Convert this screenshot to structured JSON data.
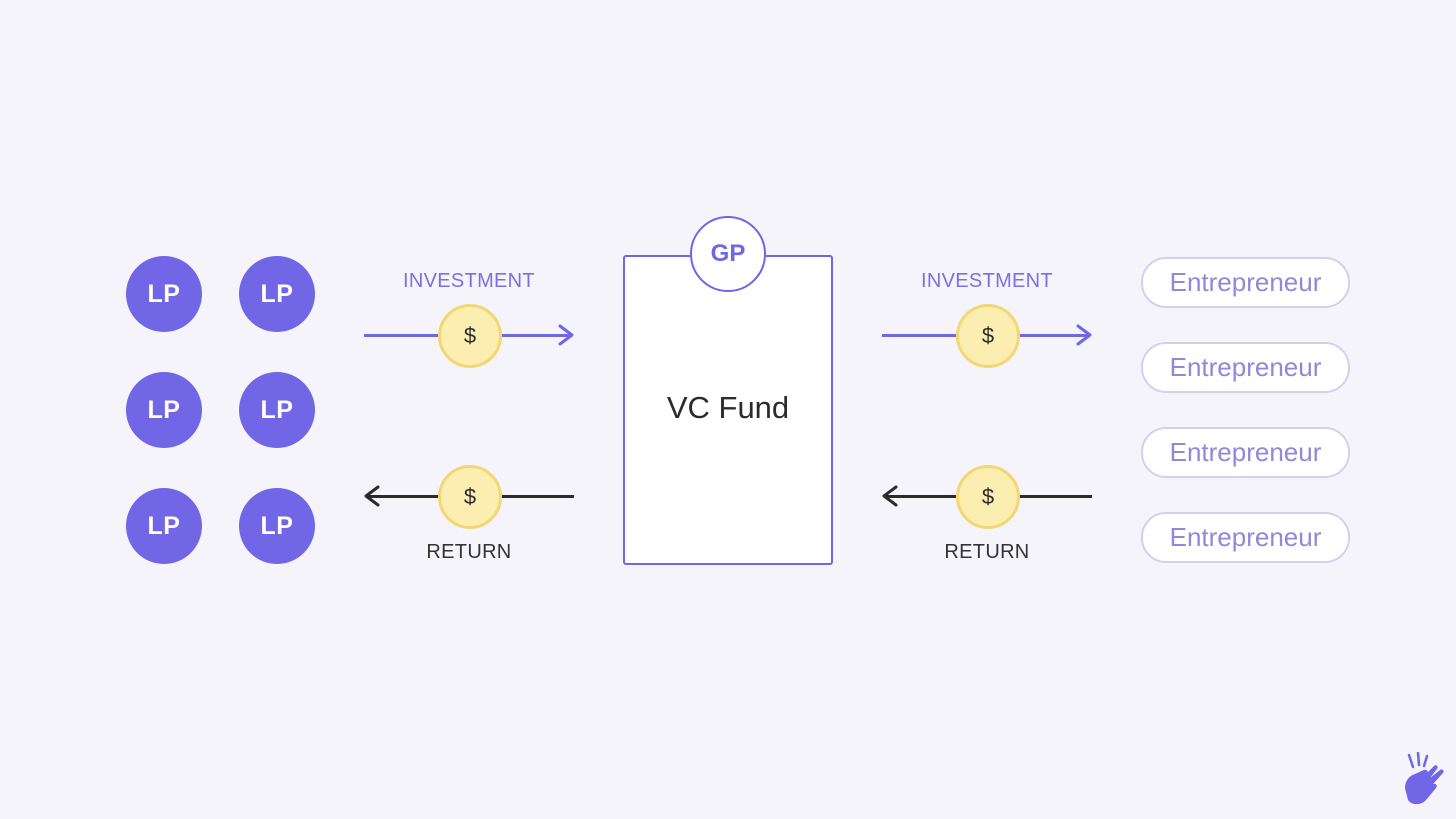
{
  "limited_partners": [
    "LP",
    "LP",
    "LP",
    "LP",
    "LP",
    "LP"
  ],
  "left_flow": {
    "investment_label": "INVESTMENT",
    "return_label": "RETURN",
    "coin_symbol": "$"
  },
  "fund": {
    "title": "VC Fund",
    "gp_label": "GP"
  },
  "right_flow": {
    "investment_label": "INVESTMENT",
    "return_label": "RETURN",
    "coin_symbol": "$"
  },
  "entrepreneurs": [
    "Entrepreneur",
    "Entrepreneur",
    "Entrepreneur",
    "Entrepreneur"
  ],
  "colors": {
    "accent": "#7066e6",
    "background": "#f5f4fb",
    "coin_fill": "#fbeeb0",
    "coin_border": "#f2d774",
    "return_line": "#2b2b2b",
    "entrepreneur_text": "#9088d8"
  },
  "icons": {
    "brand_logo": "hand-snap-icon"
  }
}
